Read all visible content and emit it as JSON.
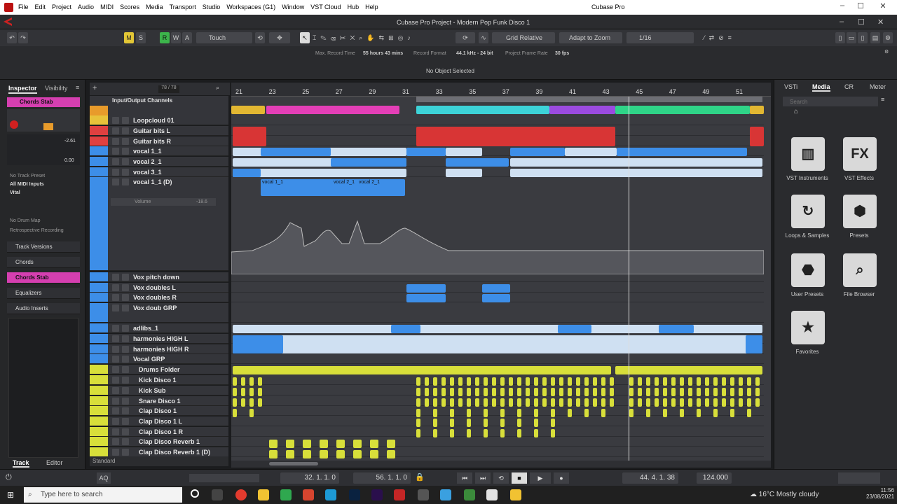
{
  "menubar": {
    "items": [
      "File",
      "Edit",
      "Project",
      "Audio",
      "MIDI",
      "Scores",
      "Media",
      "Transport",
      "Studio",
      "Workspaces (G1)",
      "Window",
      "VST Cloud",
      "Hub",
      "Help"
    ],
    "app_title": "Cubase Pro"
  },
  "project": {
    "title": "Cubase Pro Project - Modern Pop Funk Disco 1"
  },
  "toolbar": {
    "automation_mode": "Touch",
    "grid_type": "Grid Relative",
    "snap_mode": "Adapt to Zoom",
    "quantize": "1/16",
    "m_label": "M",
    "s_label": "S",
    "r_label": "R",
    "w_label": "W",
    "a_label": "A"
  },
  "infoline": {
    "max_record_label": "Max. Record Time",
    "max_record_value": "55 hours 43 mins",
    "record_format_label": "Record Format",
    "record_format_value": "44.1 kHz - 24 bit",
    "frame_rate_label": "Project Frame Rate",
    "frame_rate_value": "30 fps",
    "status": "No Object Selected"
  },
  "inspector": {
    "tabs": [
      "Inspector",
      "Visibility"
    ],
    "track_name": "Chords Stab",
    "no_track_preset": "No Track Preset",
    "midi_input": "All MIDI Inputs",
    "instrument": "Vital",
    "no_drum_map": "No Drum Map",
    "retro_record": "Retrospective Recording",
    "sections": [
      "Track Versions",
      "Chords",
      "Chords Stab",
      "Equalizers",
      "Audio Inserts"
    ],
    "bottom_tabs": [
      "Track",
      "Editor"
    ],
    "values": [
      "-2.61",
      "0.00"
    ]
  },
  "trackcount": "78 / 78",
  "trackheader": {
    "io_label": "Input/Output Channels"
  },
  "tracks": [
    {
      "name": "Loopcloud 01",
      "color": "#e8c23a"
    },
    {
      "name": "Guitar bits L",
      "color": "#e04040"
    },
    {
      "name": "Guitar bits R",
      "color": "#e04040"
    },
    {
      "name": "vocal 1_1",
      "color": "#3d8ee8"
    },
    {
      "name": "vocal 2_1",
      "color": "#3d8ee8"
    },
    {
      "name": "vocal 3_1",
      "color": "#3d8ee8"
    },
    {
      "name": "vocal 1_1 (D)",
      "color": "#3d8ee8"
    },
    {
      "name": "Vox pitch down",
      "color": "#3d8ee8"
    },
    {
      "name": "Vox doubles L",
      "color": "#3d8ee8"
    },
    {
      "name": "Vox doubles R",
      "color": "#3d8ee8"
    },
    {
      "name": "Vox doub GRP",
      "color": "#3d8ee8"
    },
    {
      "name": "adlibs_1",
      "color": "#3d8ee8"
    },
    {
      "name": "harmonies HIGH L",
      "color": "#3d8ee8"
    },
    {
      "name": "harmonies HIGH R",
      "color": "#3d8ee8"
    },
    {
      "name": "Vocal GRP",
      "color": "#3d8ee8"
    },
    {
      "name": "Drums Folder",
      "color": "#d8df3a"
    },
    {
      "name": "Kick Disco 1",
      "color": "#d8df3a"
    },
    {
      "name": "Kick Sub",
      "color": "#d8df3a"
    },
    {
      "name": "Snare Disco 1",
      "color": "#d8df3a"
    },
    {
      "name": "Clap Disco 1",
      "color": "#d8df3a"
    },
    {
      "name": "Clap Disco 1 L",
      "color": "#d8df3a"
    },
    {
      "name": "Clap Disco 1 R",
      "color": "#d8df3a"
    },
    {
      "name": "Clap Disco Reverb 1",
      "color": "#d8df3a"
    },
    {
      "name": "Clap Disco Reverb 1 (D)",
      "color": "#d8df3a"
    }
  ],
  "automation": {
    "param": "Volume",
    "value": "-18.6"
  },
  "footer_label": "Standard",
  "ruler": [
    "21",
    "23",
    "25",
    "27",
    "29",
    "31",
    "33",
    "35",
    "37",
    "39",
    "41",
    "43",
    "45",
    "47",
    "49",
    "51"
  ],
  "events": {
    "vocal_labels": [
      "vocal 1_1",
      "vocal 2_1",
      "vocal 2_1"
    ]
  },
  "mediabay": {
    "tabs": [
      "VSTi",
      "Media",
      "CR",
      "Meter"
    ],
    "search_placeholder": "Search",
    "tiles": [
      {
        "label": "VST Instruments",
        "icon": "piano-icon",
        "glyph": "▥"
      },
      {
        "label": "VST Effects",
        "icon": "fx-icon",
        "glyph": "FX"
      },
      {
        "label": "Loops & Samples",
        "icon": "loop-icon",
        "glyph": "↻"
      },
      {
        "label": "Presets",
        "icon": "hexagons-icon",
        "glyph": "⬢"
      },
      {
        "label": "User Presets",
        "icon": "user-preset-icon",
        "glyph": "⬣"
      },
      {
        "label": "File Browser",
        "icon": "file-browser-icon",
        "glyph": "⌕"
      },
      {
        "label": "Favorites",
        "icon": "star-icon",
        "glyph": "★"
      }
    ]
  },
  "transport": {
    "left_locator": "32. 1. 1.  0",
    "right_locator": "56. 1. 1.  0",
    "position": "44. 4. 1. 38",
    "tempo": "124.000",
    "aq_label": "AQ"
  },
  "taskbar": {
    "search_placeholder": "Type here to search",
    "weather": "16°C  Mostly cloudy",
    "time": "11:56",
    "date": "23/08/2021"
  },
  "colors": {
    "accent": "#c21d1d",
    "select_blue": "#3d8ee8",
    "yellow": "#d8df3a",
    "magenta": "#e43fb7",
    "cyan": "#3dd3d8"
  }
}
